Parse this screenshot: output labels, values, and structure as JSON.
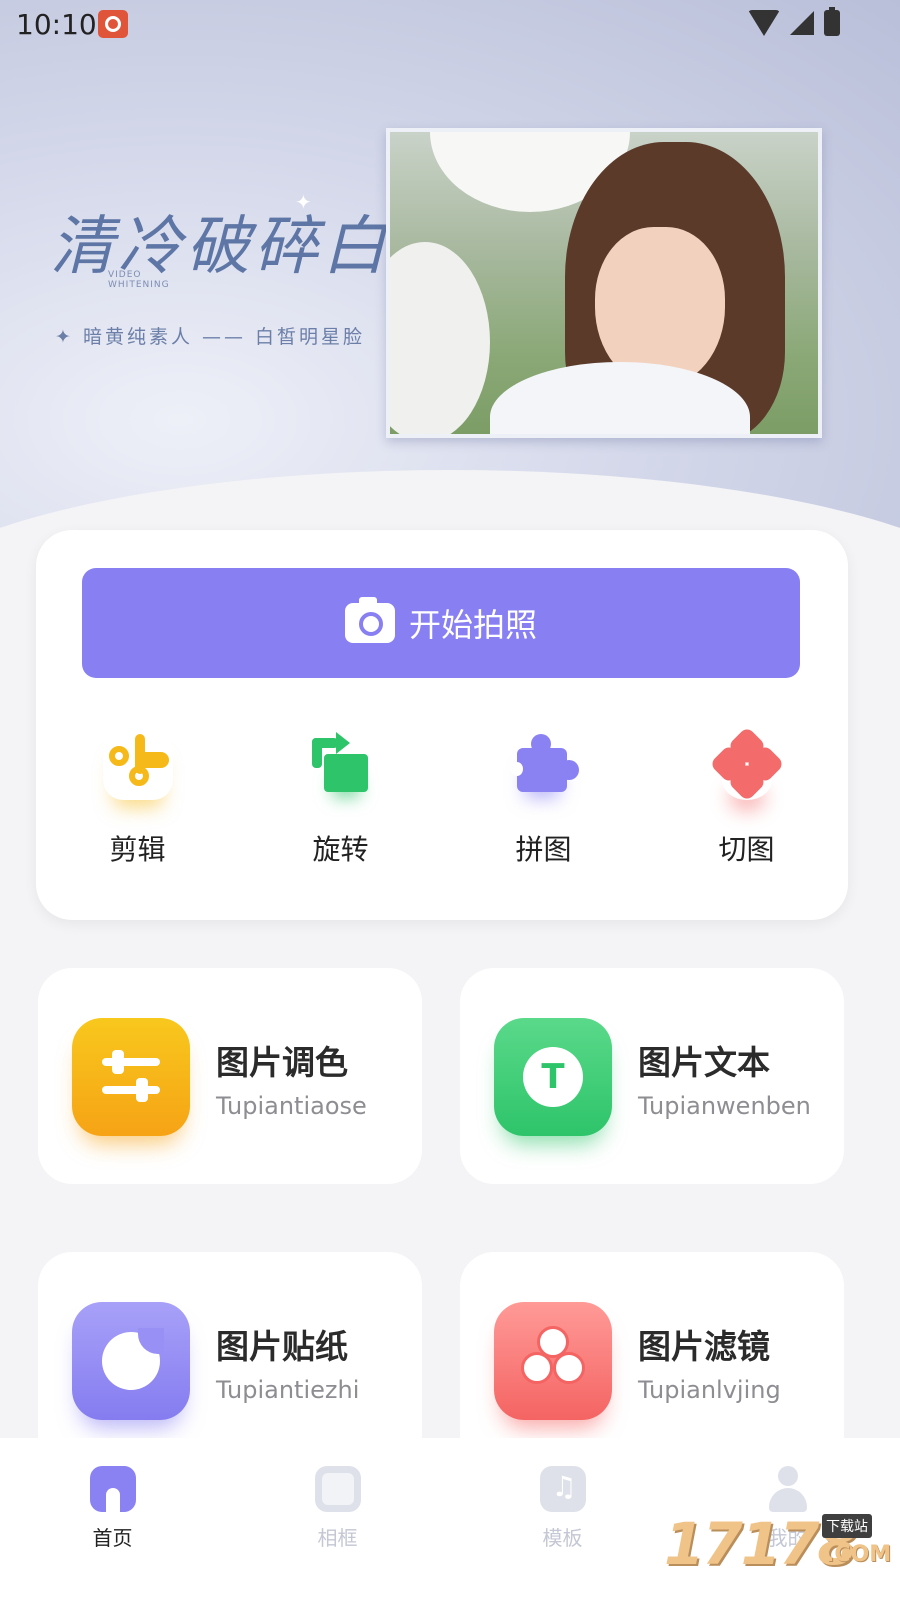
{
  "status_bar": {
    "time": "10:10"
  },
  "banner": {
    "slogan": "清冷破碎白",
    "slogan_en_1": "VIDEO",
    "slogan_en_2": "WHITENING",
    "subline": "✦ 暗黄纯素人 —— 白皙明星脸"
  },
  "action": {
    "start_label": "开始拍照",
    "tools": [
      {
        "label": "剪辑",
        "icon": "scissors-icon"
      },
      {
        "label": "旋转",
        "icon": "rotate-icon"
      },
      {
        "label": "拼图",
        "icon": "puzzle-icon"
      },
      {
        "label": "切图",
        "icon": "cut-icon"
      }
    ]
  },
  "features": [
    {
      "title": "图片调色",
      "subtitle": "Tupiantiaose",
      "icon": "sliders-icon",
      "color": "#f6a315"
    },
    {
      "title": "图片文本",
      "subtitle": "Tupianwenben",
      "icon": "text-icon",
      "color": "#2ec46a"
    },
    {
      "title": "图片贴纸",
      "subtitle": "Tupiantiezhi",
      "icon": "sticker-icon",
      "color": "#857cf0"
    },
    {
      "title": "图片滤镜",
      "subtitle": "Tupianlvjing",
      "icon": "filter-icon",
      "color": "#f46463"
    }
  ],
  "nav": [
    {
      "label": "首页",
      "icon": "home-icon",
      "active": true
    },
    {
      "label": "相框",
      "icon": "frame-icon",
      "active": false
    },
    {
      "label": "模板",
      "icon": "template-icon",
      "active": false
    },
    {
      "label": "我的",
      "icon": "profile-icon",
      "active": false
    }
  ],
  "watermark": {
    "number": "17178",
    "tag": "下载站",
    "com": ".COM"
  },
  "colors": {
    "accent": "#8880f2",
    "background": "#f4f4f6"
  }
}
